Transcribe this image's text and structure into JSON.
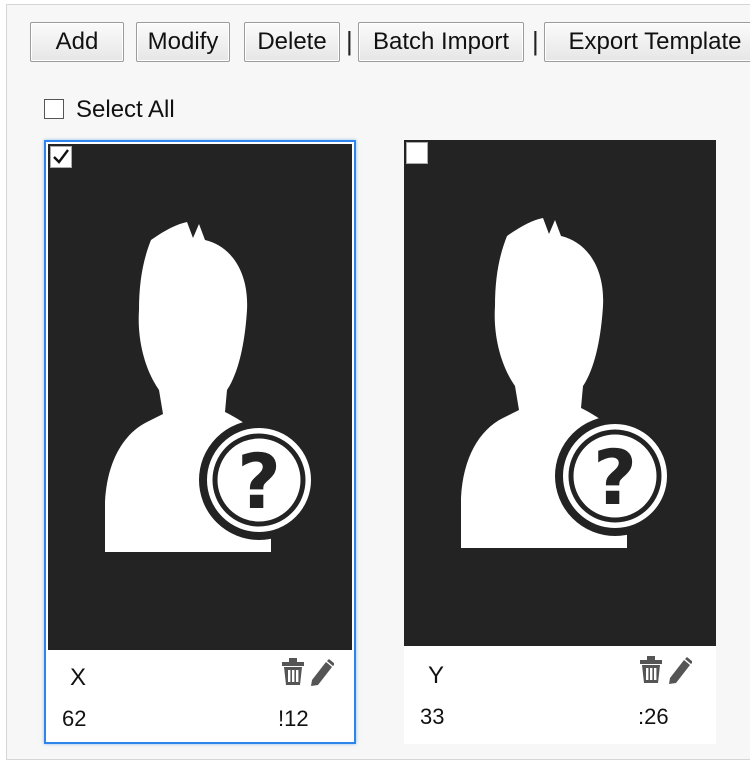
{
  "toolbar": {
    "add_label": "Add",
    "modify_label": "Modify",
    "delete_label": "Delete",
    "separator": "|",
    "batch_import_label": "Batch Import",
    "export_template_label": "Export Template"
  },
  "select_all": {
    "label": "Select All",
    "checked": false
  },
  "cards": [
    {
      "name": "X",
      "code": "62",
      "secondary": "!12",
      "checked": true,
      "selected": true,
      "icons": [
        "trash-icon",
        "pencil-icon"
      ]
    },
    {
      "name": "Y",
      "code": "33",
      "secondary": ":26",
      "checked": false,
      "selected": false,
      "icons": [
        "trash-icon",
        "pencil-icon"
      ]
    }
  ],
  "colors": {
    "accent": "#2f86ea",
    "photo_bg": "#232323",
    "panel_bg": "#f7f7f7"
  }
}
